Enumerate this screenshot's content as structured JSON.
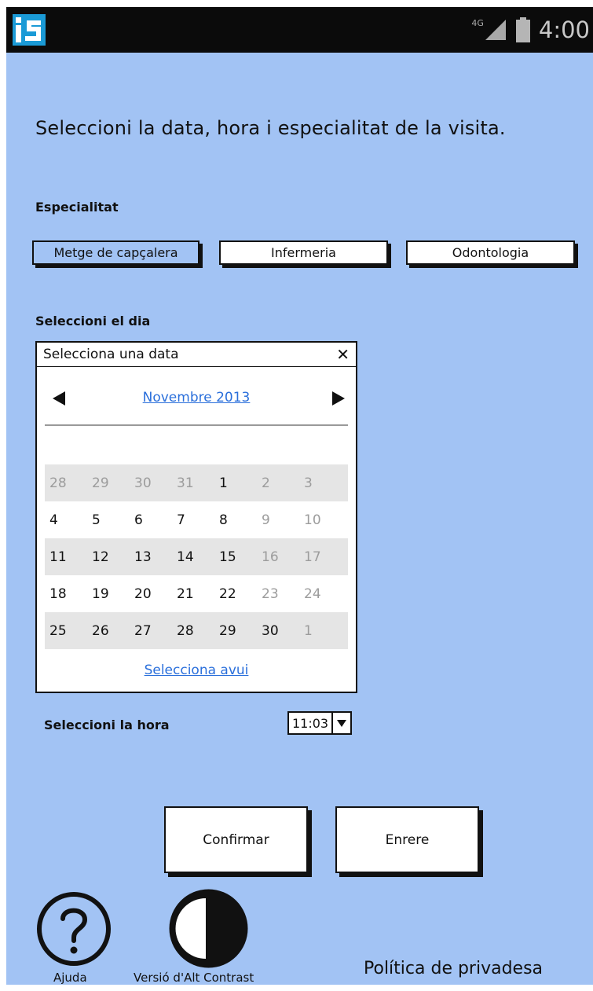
{
  "status_bar": {
    "network": "4G",
    "time": "4:00"
  },
  "heading": "Seleccioni  la data, hora i especialitat de la visita.",
  "specialty": {
    "label": "Especialitat",
    "options": [
      "Metge de capçalera",
      "Infermeria",
      "Odontologia"
    ],
    "selected": "Metge de capçalera"
  },
  "day": {
    "label": "Seleccioni el  dia",
    "calendar": {
      "title": "Selecciona una data",
      "month": "Novembre 2013",
      "weeks": [
        [
          {
            "d": "28",
            "m": true
          },
          {
            "d": "29",
            "m": true
          },
          {
            "d": "30",
            "m": true
          },
          {
            "d": "31",
            "m": true
          },
          {
            "d": "1",
            "m": false
          },
          {
            "d": "2",
            "m": true
          },
          {
            "d": "3",
            "m": true
          }
        ],
        [
          {
            "d": "4",
            "m": false
          },
          {
            "d": "5",
            "m": false
          },
          {
            "d": "6",
            "m": false
          },
          {
            "d": "7",
            "m": false
          },
          {
            "d": "8",
            "m": false
          },
          {
            "d": "9",
            "m": true
          },
          {
            "d": "10",
            "m": true
          }
        ],
        [
          {
            "d": "11",
            "m": false
          },
          {
            "d": "12",
            "m": false
          },
          {
            "d": "13",
            "m": false
          },
          {
            "d": "14",
            "m": false
          },
          {
            "d": "15",
            "m": false
          },
          {
            "d": "16",
            "m": true
          },
          {
            "d": "17",
            "m": true
          }
        ],
        [
          {
            "d": "18",
            "m": false
          },
          {
            "d": "19",
            "m": false
          },
          {
            "d": "20",
            "m": false
          },
          {
            "d": "21",
            "m": false
          },
          {
            "d": "22",
            "m": false
          },
          {
            "d": "23",
            "m": true
          },
          {
            "d": "24",
            "m": true
          }
        ],
        [
          {
            "d": "25",
            "m": false
          },
          {
            "d": "26",
            "m": false
          },
          {
            "d": "27",
            "m": false
          },
          {
            "d": "28",
            "m": false
          },
          {
            "d": "29",
            "m": false
          },
          {
            "d": "30",
            "m": false
          },
          {
            "d": "1",
            "m": true
          }
        ]
      ],
      "today_link": "Selecciona avui"
    }
  },
  "hour": {
    "label": "Seleccioni la hora",
    "value": "11:03"
  },
  "actions": {
    "confirm": "Confirmar",
    "back": "Enrere"
  },
  "footer": {
    "help": "Ajuda",
    "contrast": "Versió d'Alt Contrast",
    "privacy": "Política de privadesa"
  }
}
